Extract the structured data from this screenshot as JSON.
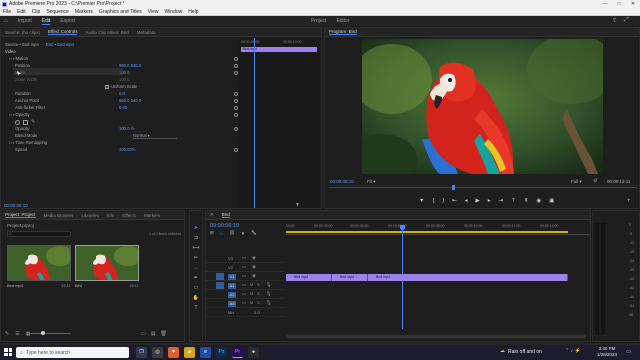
{
  "window": {
    "title": "Adobe Premiere Pro 2023 - C:\\Premier Pro\\Project *",
    "controls": [
      "—",
      "□",
      "✕"
    ]
  },
  "menu": [
    "File",
    "Edit",
    "Clip",
    "Sequence",
    "Markers",
    "Graphics and Titles",
    "View",
    "Window",
    "Help"
  ],
  "workspace": {
    "left": [
      "Import",
      "Edit",
      "Export"
    ],
    "active": "Edit",
    "right": [
      "Project",
      "Editor"
    ]
  },
  "effect_controls": {
    "tabs": [
      "Source: (no clips)",
      "Effect Controls",
      "Audio Clip Mixer: Bird",
      "Metadata"
    ],
    "active_tab": "Effect Controls",
    "source_label": "Source • Bird.mp4",
    "clip_label": "Bird • Bird.mp4",
    "section_video": "Video",
    "rows": [
      {
        "label": "Motion",
        "value": ""
      },
      {
        "label": "Position",
        "value": "960.0    540.0"
      },
      {
        "label": "Scale",
        "value": "100.0"
      },
      {
        "label": "Scale Width",
        "value": "100.0"
      },
      {
        "label": "Uniform Scale",
        "value": ""
      },
      {
        "label": "Rotation",
        "value": "0.0"
      },
      {
        "label": "Anchor Point",
        "value": "960.0    540.0"
      },
      {
        "label": "Anti-flicker Filter",
        "value": "0.00"
      },
      {
        "label": "Opacity",
        "value": ""
      },
      {
        "label": "Opacity",
        "value": "100.0 %"
      },
      {
        "label": "Blend Mode",
        "value": "Normal"
      },
      {
        "label": "Time Remapping",
        "value": ""
      },
      {
        "label": "Speed",
        "value": "100.00%"
      }
    ],
    "tl_time": "00:00:05:00",
    "tl_time2": "00:00:10:00",
    "tl_clip": "Bird.mp4",
    "timecode": "00:00:06:10"
  },
  "program": {
    "title": "Program: Bird",
    "timecode": "00:00:06:10",
    "fit": "Fit",
    "quality": "Full",
    "duration": "00:00:13:11"
  },
  "project": {
    "tabs": [
      "Project: Project",
      "Media Browser",
      "Libraries",
      "Info",
      "Effects",
      "Markers"
    ],
    "active_tab": "Project: Project",
    "path": "Project.prproj",
    "count": "1 of 3 items selected",
    "items": [
      {
        "name": "Bird.mp4",
        "duration": "13:11"
      },
      {
        "name": "Bird",
        "duration": "13:11"
      }
    ]
  },
  "timeline": {
    "tab": "Bird",
    "timecode": "00:00:06:10",
    "ruler": [
      "00:00",
      "00:00:02:00",
      "00:00:04:00",
      "00:00:06:00",
      "00:00:08:00",
      "00:00:10:00",
      "00:00:12:00",
      "00:00:14:00"
    ],
    "tracks": [
      "V3",
      "V2",
      "V1",
      "A1",
      "A2",
      "A3",
      "Mix"
    ],
    "mix_value": "0.0",
    "clips": [
      "Bird.mp4",
      "Bird.mp4",
      "Bird.mp4"
    ]
  },
  "meters": {
    "scale": [
      "0",
      "-6",
      "-12",
      "-18",
      "-24",
      "-30",
      "-36",
      "-42",
      "-48",
      "-54",
      "dB"
    ]
  },
  "taskbar": {
    "search": "Type here to search",
    "weather": "Rain off and on",
    "time": "3:40 PM",
    "date": "1/28/2023"
  }
}
